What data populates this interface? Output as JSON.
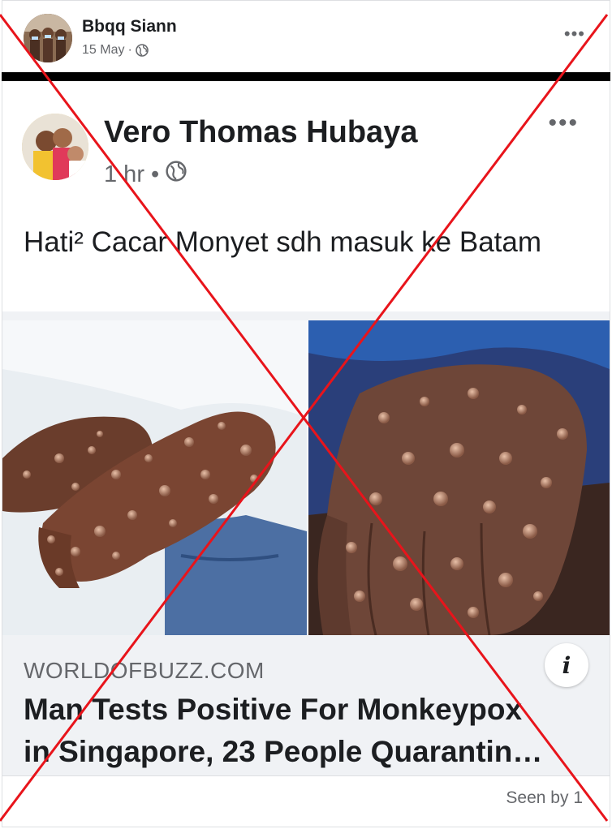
{
  "outer_post": {
    "author": "Bbqq Siann",
    "date": "15 May",
    "separator": "·"
  },
  "shared_post": {
    "author": "Vero Thomas Hubaya",
    "time": "1 hr",
    "separator": "•",
    "text": "Hati² Cacar Monyet sdh masuk ke Batam"
  },
  "link_preview": {
    "domain": "WORLDOFBUZZ.COM",
    "title_line1": "Man Tests Positive For Monkeypox",
    "title_line2": "in Singapore, 23 People Quarantin…",
    "info_label": "i"
  },
  "footer": {
    "seen_by": "Seen by 1"
  },
  "overlay": {
    "color": "#e8141b"
  },
  "icons": [
    "globe-icon",
    "more-options-icon",
    "info-icon"
  ]
}
